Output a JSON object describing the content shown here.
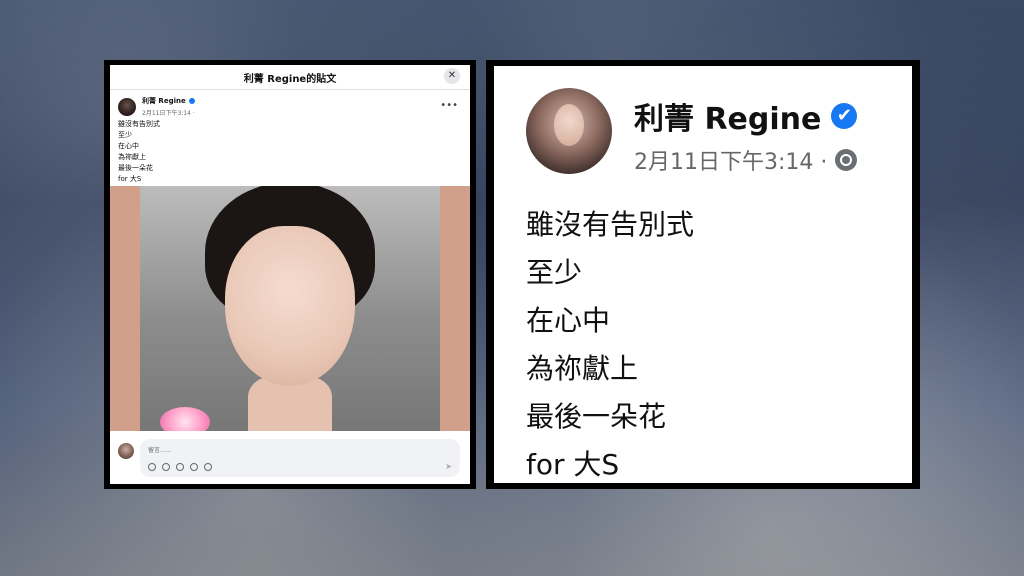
{
  "left_post": {
    "window_title": "利菁 Regine的貼文",
    "author_name": "利菁 Regine",
    "timestamp": "2月11日下午3:14 ·",
    "content_lines": [
      "雖沒有告別式",
      "至少",
      "在心中",
      "為祢獻上",
      "最後一朵花",
      "for 大S"
    ],
    "comment_placeholder": "留言......"
  },
  "right_zoom": {
    "author_name": "利菁 Regine",
    "timestamp": "2月11日下午3:14 ·",
    "content_lines": [
      "雖沒有告別式",
      "至少",
      "在心中",
      "為祢獻上",
      "最後一朵花",
      "for 大S"
    ]
  },
  "colors": {
    "verified_blue": "#1877f2",
    "panel_border": "#000000"
  },
  "icons": {
    "close": "close-icon",
    "more": "more-options-icon",
    "verified": "verified-badge-icon",
    "globe": "globe-icon",
    "send": "send-icon"
  }
}
